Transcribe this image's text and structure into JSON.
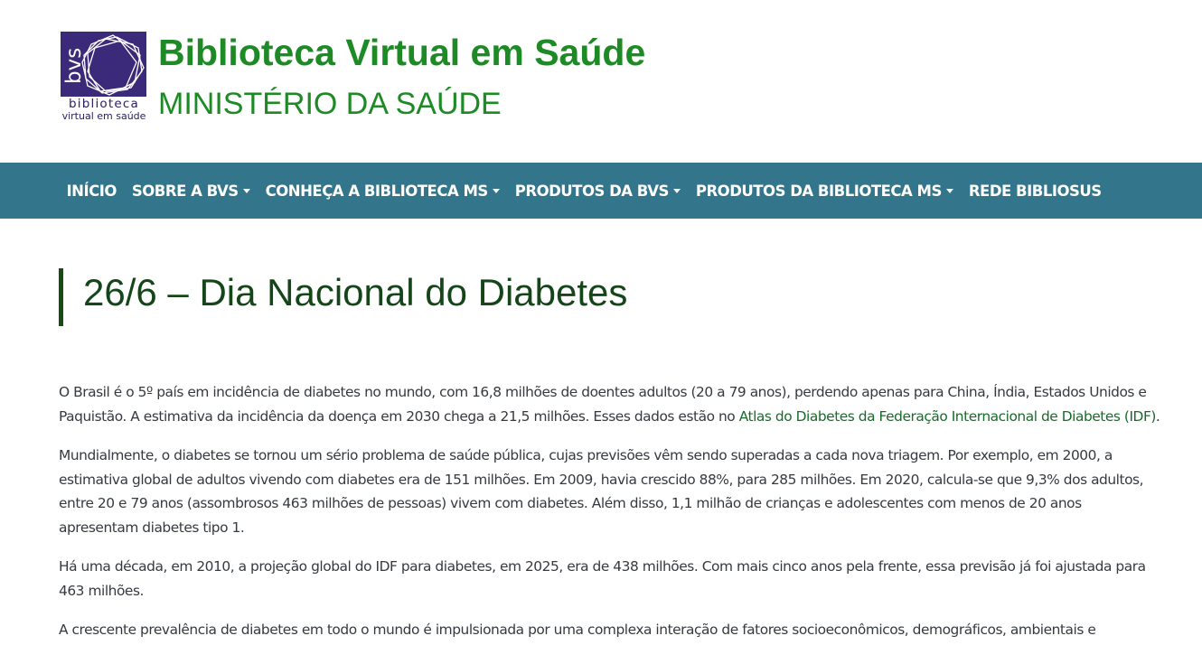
{
  "header": {
    "logo": {
      "icon": "bvs-logo-icon",
      "mark_text": "bvs",
      "line1": "biblioteca",
      "line2": "virtual em saúde",
      "bg_color": "#3b2a7a"
    },
    "title": "Biblioteca Virtual em Saúde",
    "subtitle": "MINISTÉRIO DA SAÚDE",
    "title_color": "#1d8a26"
  },
  "nav": {
    "bg_color": "#33758a",
    "items": [
      {
        "label": "INÍCIO",
        "dropdown": false
      },
      {
        "label": "SOBRE A BVS",
        "dropdown": true
      },
      {
        "label": "CONHEÇA A BIBLIOTECA MS",
        "dropdown": true
      },
      {
        "label": "PRODUTOS DA BVS",
        "dropdown": true
      },
      {
        "label": "PRODUTOS DA BIBLIOTECA MS",
        "dropdown": true
      },
      {
        "label": "REDE BIBLIOSUS",
        "dropdown": false
      }
    ]
  },
  "article": {
    "title": "26/6 – Dia Nacional do Diabetes",
    "p1_before": "O Brasil é o 5º país em incidência de diabetes no mundo, com 16,8 milhões de doentes adultos (20 a 79 anos), perdendo apenas para China, Índia, Estados Unidos e Paquistão. A estimativa da incidência da doença em 2030 chega a 21,5 milhões. Esses dados estão no ",
    "p1_link": "Atlas do Diabetes da Federação Internacional de Diabetes (IDF)",
    "p1_after": ".",
    "p2": "Mundialmente, o diabetes se tornou um sério problema de saúde pública, cujas previsões vêm sendo superadas a cada nova triagem. Por exemplo, em 2000, a estimativa global de adultos vivendo com diabetes era de 151 milhões. Em 2009, havia crescido 88%, para 285 milhões. Em 2020, calcula-se que 9,3% dos adultos, entre 20 e 79 anos (assombrosos 463 milhões de pessoas) vivem com diabetes. Além disso, 1,1 milhão de crianças e adolescentes com menos de 20 anos apresentam diabetes tipo 1.",
    "p3": "Há uma década, em 2010, a projeção global do IDF para diabetes, em 2025, era de 438 milhões. Com mais cinco anos pela frente, essa previsão já foi ajustada para 463 milhões.",
    "p4": "A crescente prevalência de diabetes em todo o mundo é impulsionada por uma complexa interação de fatores socioeconômicos, demográficos, ambientais e"
  }
}
